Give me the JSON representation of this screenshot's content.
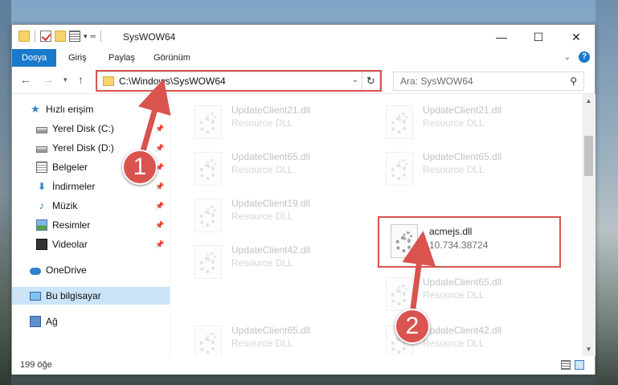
{
  "window": {
    "title": "SysWOW64",
    "controls": {
      "minimize": "—",
      "maximize": "☐",
      "close": "✕"
    }
  },
  "ribbon": {
    "tabs": [
      {
        "label": "Dosya",
        "active": true
      },
      {
        "label": "Giriş"
      },
      {
        "label": "Paylaş"
      },
      {
        "label": "Görünüm"
      }
    ],
    "help": "?"
  },
  "address": {
    "path": "C:\\Windows\\SysWOW64",
    "search_placeholder": "Ara: SysWOW64"
  },
  "nav": {
    "items": [
      {
        "label": "Hızlı erişim",
        "icon": "star-icon"
      },
      {
        "label": "Yerel Disk (C:)",
        "icon": "disk-icon",
        "pinned": true
      },
      {
        "label": "Yerel Disk (D:)",
        "icon": "disk-icon",
        "pinned": true
      },
      {
        "label": "Belgeler",
        "icon": "document-icon",
        "pinned": true
      },
      {
        "label": "İndirmeler",
        "icon": "download-icon",
        "pinned": true
      },
      {
        "label": "Müzik",
        "icon": "music-icon",
        "pinned": true
      },
      {
        "label": "Resimler",
        "icon": "pictures-icon",
        "pinned": true
      },
      {
        "label": "Videolar",
        "icon": "videos-icon",
        "pinned": true
      },
      {
        "label": "OneDrive",
        "icon": "cloud-icon"
      },
      {
        "label": "Bu bilgisayar",
        "icon": "computer-icon",
        "selected": true
      },
      {
        "label": "Ağ",
        "icon": "network-icon"
      }
    ]
  },
  "files": [
    {
      "name": "UpdateClient21.dll",
      "desc": "Resource DLL"
    },
    {
      "name": "UpdateClient21.dll",
      "desc": "Resource DLL"
    },
    {
      "name": "UpdateClient65.dll",
      "desc": "Resource DLL"
    },
    {
      "name": "UpdateClient65.dll",
      "desc": "Resource DLL"
    },
    {
      "name": "UpdateClient19.dll",
      "desc": "Resource DLL"
    },
    {
      "name": "acmejs.dll",
      "desc": "10.734.38724"
    },
    {
      "name": "UpdateClient42.dll",
      "desc": "Resource DLL"
    },
    {
      "name": "UpdateClient65.dll",
      "desc": "Resource DLL"
    },
    {
      "name": "UpdateClient65.dll",
      "desc": "Resource DLL"
    },
    {
      "name": "UpdateClient42.dll",
      "desc": "Resource DLL"
    }
  ],
  "status": {
    "item_count": "199 öğe"
  },
  "callouts": {
    "one": "1",
    "two": "2"
  },
  "colors": {
    "accent": "#1979ca",
    "highlight": "#d9534f",
    "selected_bg": "#cce4f7"
  }
}
